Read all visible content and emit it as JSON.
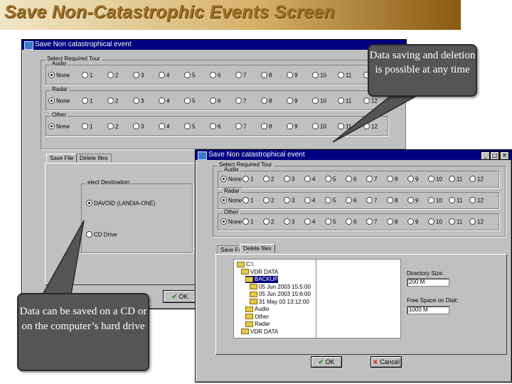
{
  "slide": {
    "title": "Save Non-Catastrophic Events Screen"
  },
  "back_window": {
    "title": "Save Non catastrophical event",
    "select_group_label": "Select Required Tour",
    "rows": [
      {
        "label": "Audio",
        "none": "None"
      },
      {
        "label": "Radar",
        "none": "None"
      },
      {
        "label": "Other",
        "none": "None"
      }
    ],
    "numbers": [
      "1",
      "2",
      "3",
      "4",
      "5",
      "6",
      "7",
      "8",
      "9",
      "10",
      "11",
      "12"
    ],
    "tabs": [
      "Save File",
      "Delete files"
    ],
    "dest_group_label": "elect Destination",
    "dest_options": [
      "DAVOID (LANDIA-ONE)",
      "CD Drive"
    ],
    "ok_label": "OK"
  },
  "front_window": {
    "title": "Save Non catastrophical event",
    "select_group_label": "Select Required Tour",
    "rows": [
      {
        "label": "Audio",
        "none": "None"
      },
      {
        "label": "Radar",
        "none": "None"
      },
      {
        "label": "Other",
        "none": "None"
      }
    ],
    "numbers": [
      "1",
      "2",
      "3",
      "4",
      "5",
      "6",
      "7",
      "8",
      "9",
      "10",
      "11",
      "12"
    ],
    "tabs": [
      "Save File",
      "Delete files"
    ],
    "tree": [
      "C:\\",
      "VDR DATA",
      "BACKUP",
      "05 Jun 2003 15:5:00",
      "05 Jun 2003 15:6:00",
      "31 May 03 13:12:00",
      "Audio",
      "Other",
      "Radar",
      "VDR DATA"
    ],
    "dir_size_label": "Directory Size:",
    "dir_size_value": "200 M",
    "free_space_label": "Free Space on Disk:",
    "free_space_value": "1000 M",
    "ok_label": "OK",
    "cancel_label": "Cancel"
  },
  "callouts": {
    "top_right": "Data saving and deletion is possible at any time",
    "bottom_left": "Data can be saved on a CD or on the computer’s hard drive"
  },
  "colors": {
    "title_text": "#9d7226",
    "window_bg": "#c0c0c0",
    "titlebar_bg": "#000080",
    "callout_bg": "#555555",
    "check_green": "#1a8a1a",
    "cancel_red": "#c01818"
  }
}
